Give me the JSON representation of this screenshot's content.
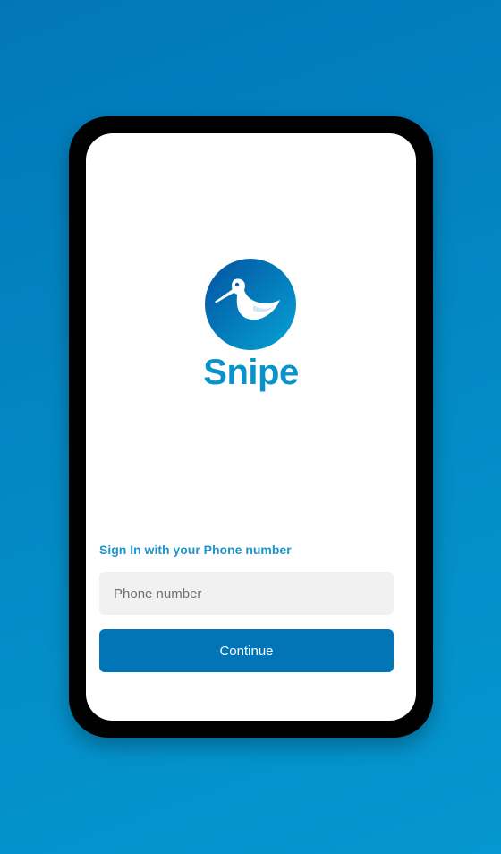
{
  "app": {
    "name": "Snipe",
    "logo_icon": "snipe-bird-icon"
  },
  "signin": {
    "label": "Sign In with your Phone number",
    "phone_placeholder": "Phone number",
    "phone_value": "",
    "continue_label": "Continue"
  },
  "colors": {
    "background_top": "#0277b8",
    "background_bottom": "#0597cf",
    "brand": "#0993c9",
    "button": "#0175b5",
    "input_bg": "#f1f1f1"
  }
}
